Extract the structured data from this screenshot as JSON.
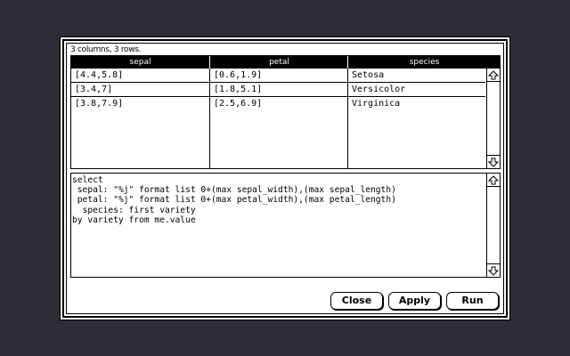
{
  "dialog": {
    "summary": "3 columns, 3 rows.",
    "table": {
      "columns": [
        "sepal",
        "petal",
        "species"
      ],
      "rows": [
        [
          "[4.4,5.8]",
          "[0.6,1.9]",
          "Setosa"
        ],
        [
          "[3.4,7]",
          "[1.8,5.1]",
          "Versicolor"
        ],
        [
          "[3.8,7.9]",
          "[2.5,6.9]",
          "Virginica"
        ]
      ]
    },
    "script": "select\n sepal: \"%j\" format list 0+(max sepal_width),(max sepal_length)\n petal: \"%j\" format list 0+(max petal_width),(max petal_length)\n  species: first variety\nby variety from me.value",
    "buttons": {
      "close": "Close",
      "apply": "Apply",
      "run": "Run"
    },
    "icons": {
      "scroll_up": "arrow-up-icon",
      "scroll_down": "arrow-down-icon"
    },
    "colors": {
      "background": "#2e2c36",
      "dialog": "#ffffff",
      "header": "#000000"
    }
  }
}
